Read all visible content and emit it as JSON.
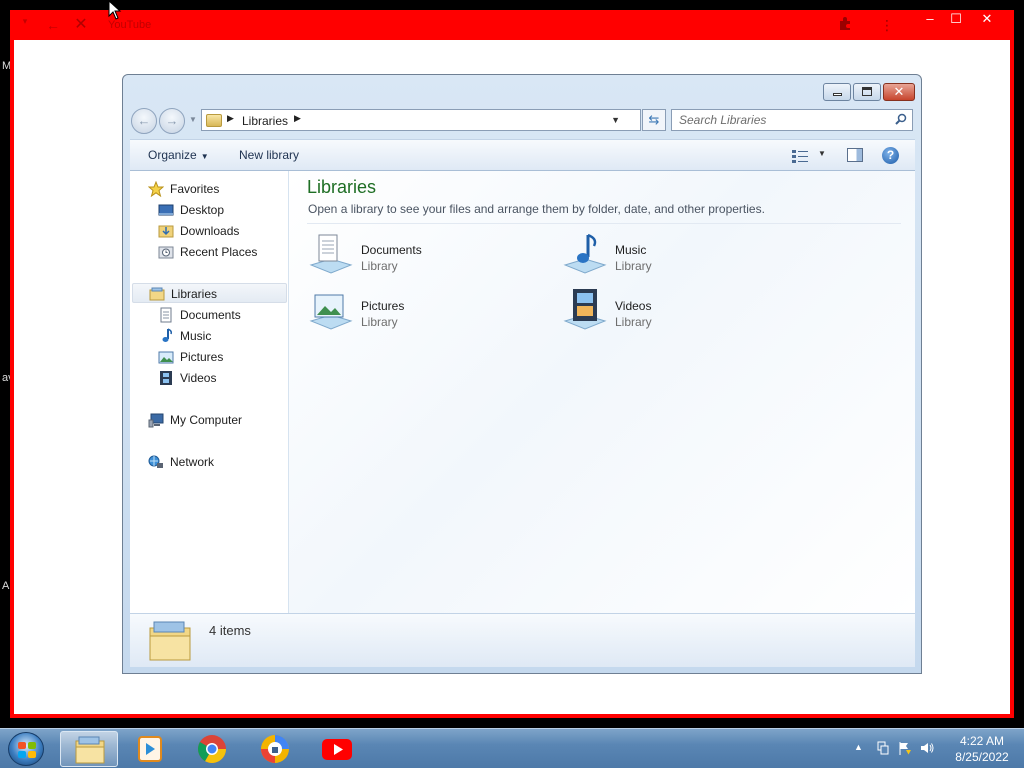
{
  "desktop": {
    "edge_letters": [
      "M",
      "av",
      "A"
    ]
  },
  "app_window": {
    "title": "YouTube",
    "controls": {
      "minimize": "–",
      "maximize": "☐",
      "close": "✕"
    }
  },
  "explorer": {
    "address": {
      "crumb": "Libraries"
    },
    "search": {
      "placeholder": "Search Libraries"
    },
    "toolbar": {
      "organize": "Organize",
      "new_library": "New library"
    },
    "nav": {
      "favorites": "Favorites",
      "favorites_items": [
        "Desktop",
        "Downloads",
        "Recent Places"
      ],
      "libraries": "Libraries",
      "libraries_items": [
        "Documents",
        "Music",
        "Pictures",
        "Videos"
      ],
      "computer": "My Computer",
      "network": "Network"
    },
    "content": {
      "title": "Libraries",
      "subtitle": "Open a library to see your files and arrange them by folder, date, and other properties.",
      "items": [
        {
          "name": "Documents",
          "type": "Library",
          "icon": "documents-library-icon"
        },
        {
          "name": "Music",
          "type": "Library",
          "icon": "music-library-icon"
        },
        {
          "name": "Pictures",
          "type": "Library",
          "icon": "pictures-library-icon"
        },
        {
          "name": "Videos",
          "type": "Library",
          "icon": "videos-library-icon"
        }
      ]
    },
    "details": {
      "count": "4 items"
    }
  },
  "taskbar": {
    "apps": [
      "file-explorer",
      "media-player",
      "chrome",
      "lock-app",
      "youtube"
    ],
    "clock": {
      "time": "4:22 AM",
      "date": "8/25/2022"
    }
  }
}
